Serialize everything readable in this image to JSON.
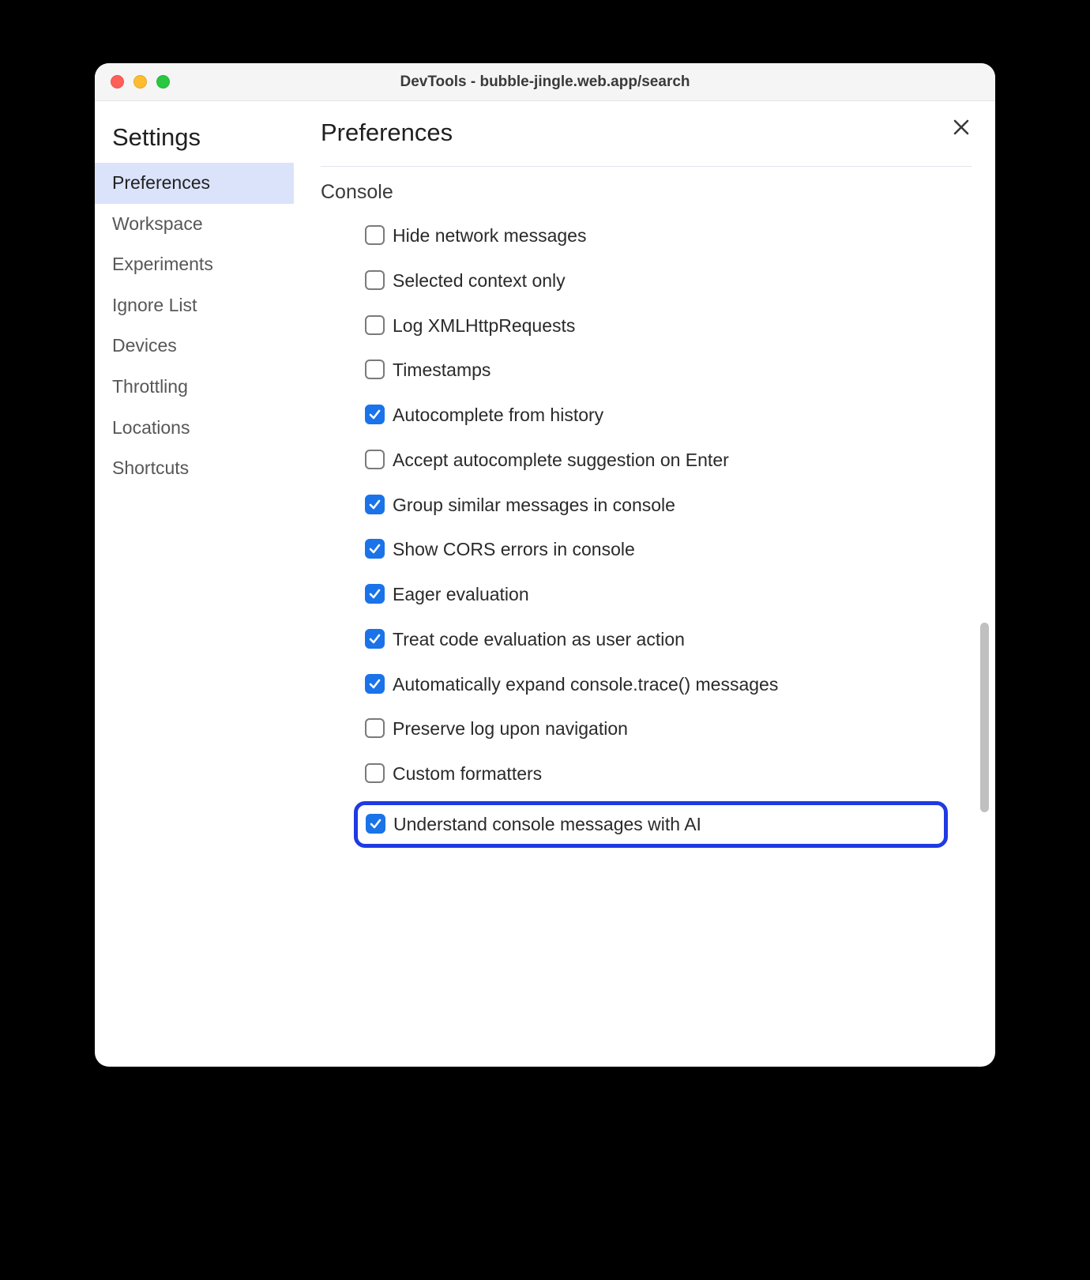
{
  "window": {
    "title": "DevTools - bubble-jingle.web.app/search"
  },
  "sidebar": {
    "title": "Settings",
    "items": [
      {
        "label": "Preferences",
        "active": true
      },
      {
        "label": "Workspace",
        "active": false
      },
      {
        "label": "Experiments",
        "active": false
      },
      {
        "label": "Ignore List",
        "active": false
      },
      {
        "label": "Devices",
        "active": false
      },
      {
        "label": "Throttling",
        "active": false
      },
      {
        "label": "Locations",
        "active": false
      },
      {
        "label": "Shortcuts",
        "active": false
      }
    ]
  },
  "main": {
    "title": "Preferences",
    "section": "Console",
    "options": [
      {
        "label": "Hide network messages",
        "checked": false,
        "highlighted": false
      },
      {
        "label": "Selected context only",
        "checked": false,
        "highlighted": false
      },
      {
        "label": "Log XMLHttpRequests",
        "checked": false,
        "highlighted": false
      },
      {
        "label": "Timestamps",
        "checked": false,
        "highlighted": false
      },
      {
        "label": "Autocomplete from history",
        "checked": true,
        "highlighted": false
      },
      {
        "label": "Accept autocomplete suggestion on Enter",
        "checked": false,
        "highlighted": false
      },
      {
        "label": "Group similar messages in console",
        "checked": true,
        "highlighted": false
      },
      {
        "label": "Show CORS errors in console",
        "checked": true,
        "highlighted": false
      },
      {
        "label": "Eager evaluation",
        "checked": true,
        "highlighted": false
      },
      {
        "label": "Treat code evaluation as user action",
        "checked": true,
        "highlighted": false
      },
      {
        "label": "Automatically expand console.trace() messages",
        "checked": true,
        "highlighted": false
      },
      {
        "label": "Preserve log upon navigation",
        "checked": false,
        "highlighted": false
      },
      {
        "label": "Custom formatters",
        "checked": false,
        "highlighted": false
      },
      {
        "label": "Understand console messages with AI",
        "checked": true,
        "highlighted": true
      }
    ]
  }
}
